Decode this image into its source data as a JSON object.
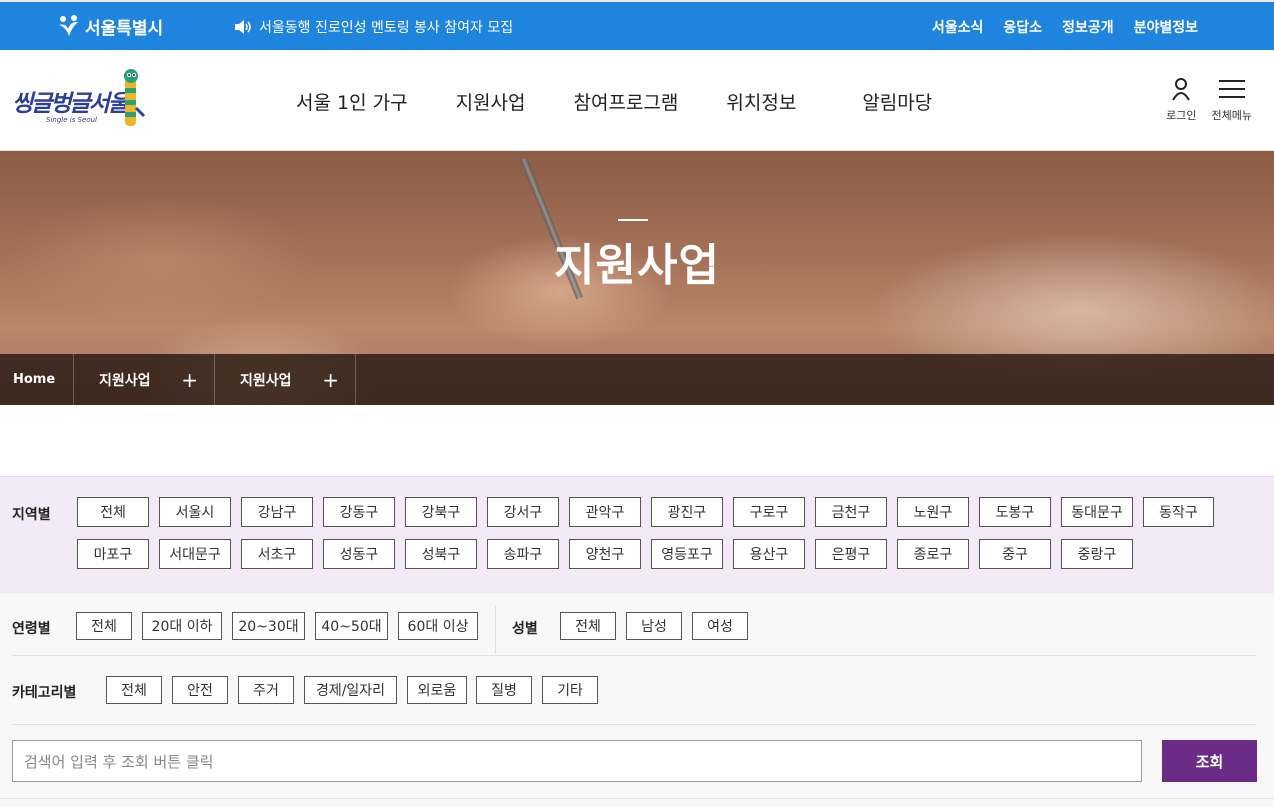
{
  "topbar": {
    "logo_text": "서울특별시",
    "notice": "서울동행 진로인성 멘토링 봉사 참여자 모집",
    "links": [
      "서울소식",
      "응답소",
      "정보공개",
      "분야별정보"
    ]
  },
  "header": {
    "brand": "씽글벙글서울",
    "brand_sub": "Single is Seoul",
    "nav": [
      "서울 1인 가구",
      "지원사업",
      "참여프로그램",
      "위치정보",
      "알림마당"
    ],
    "login": "로그인",
    "all_menu": "전체메뉴"
  },
  "hero": {
    "title": "지원사업",
    "breadcrumb": {
      "home": "Home",
      "level1": "지원사업",
      "level2": "지원사업"
    }
  },
  "filters": {
    "region_label": "지역별",
    "regions": [
      "전체",
      "서울시",
      "강남구",
      "강동구",
      "강북구",
      "강서구",
      "관악구",
      "광진구",
      "구로구",
      "금천구",
      "노원구",
      "도봉구",
      "동대문구",
      "동작구",
      "마포구",
      "서대문구",
      "서초구",
      "성동구",
      "성북구",
      "송파구",
      "양천구",
      "영등포구",
      "용산구",
      "은평구",
      "종로구",
      "중구",
      "중랑구"
    ],
    "age_label": "연령별",
    "ages": [
      "전체",
      "20대 이하",
      "20~30대",
      "40~50대",
      "60대 이상"
    ],
    "gender_label": "성별",
    "genders": [
      "전체",
      "남성",
      "여성"
    ],
    "category_label": "카테고리별",
    "categories": [
      "전체",
      "안전",
      "주거",
      "경제/일자리",
      "외로움",
      "질병",
      "기타"
    ]
  },
  "search": {
    "placeholder": "검색어 입력 후 조회 버튼 클릭",
    "button": "조회"
  }
}
